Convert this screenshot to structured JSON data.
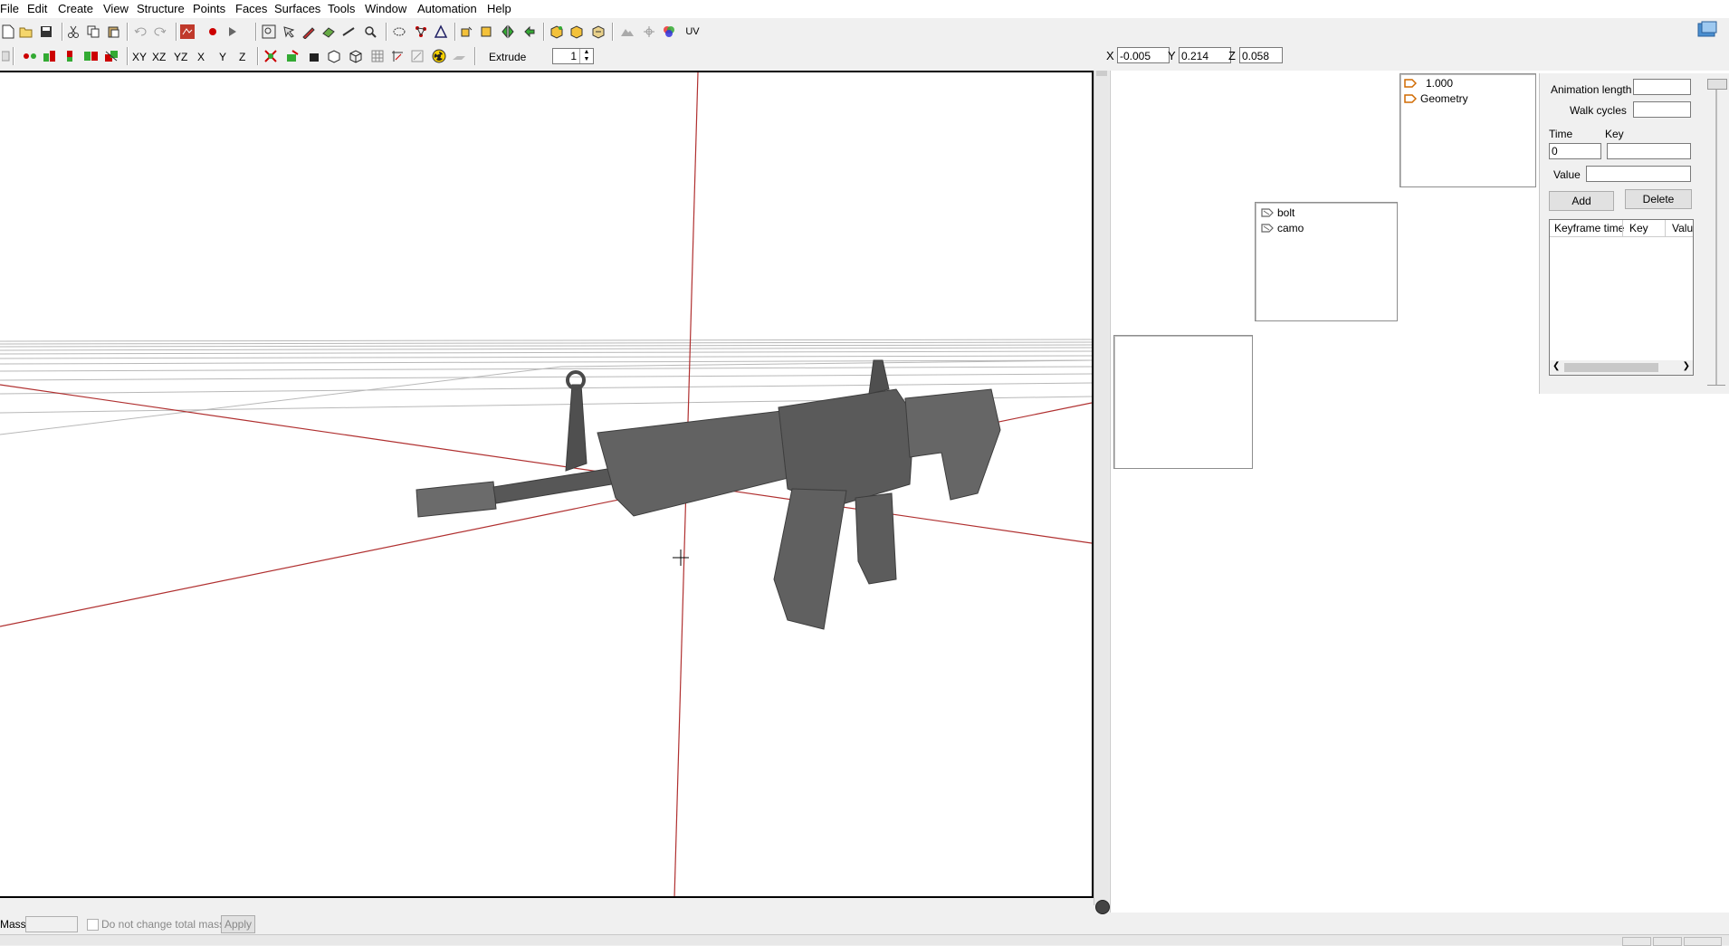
{
  "menu": [
    "File",
    "Edit",
    "Create",
    "View",
    "Structure",
    "Points",
    "Faces",
    "Surfaces",
    "Tools",
    "Window",
    "Automation",
    "Help"
  ],
  "toolbar": {
    "uv_label": "UV",
    "view_buttons": [
      "XY",
      "XZ",
      "YZ",
      "X",
      "Y",
      "Z"
    ],
    "extrude_label": "Extrude",
    "extrude_value": "1"
  },
  "coords": {
    "x_label": "X",
    "x": "-0.005",
    "y_label": "Y",
    "y": "0.214",
    "z_label": "Z",
    "z": "0.058"
  },
  "lod_panel": {
    "items": [
      "1.000",
      "Geometry"
    ]
  },
  "selection_panel": {
    "items": [
      "bolt",
      "camo"
    ]
  },
  "animation": {
    "length_label": "Animation length",
    "walk_label": "Walk cycles",
    "time_label": "Time",
    "time_value": "0",
    "key_label": "Key",
    "value_label": "Value",
    "add_label": "Add",
    "delete_label": "Delete",
    "columns": [
      "Keyframe time",
      "Key",
      "Valu"
    ]
  },
  "bottom": {
    "mass_label": "Mass:",
    "checkbox_label": "Do not change total mass",
    "apply_label": "Apply"
  }
}
